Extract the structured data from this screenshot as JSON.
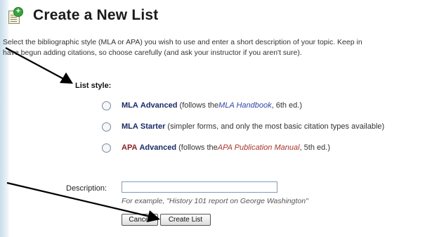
{
  "header": {
    "title": "Create a New List",
    "icon": "new-list-icon"
  },
  "intro": {
    "line1": "Select the bibliographic style (MLA or APA) you wish to use and enter a short description of your topic. Keep in",
    "line2": "have begun adding citations, so choose carefully (and ask your instructor if you aren't sure)."
  },
  "list_style": {
    "label": "List style:",
    "options": [
      {
        "name_part1": "MLA",
        "name_part2": "Advanced",
        "pre": "(follows the ",
        "ref": "MLA Handbook",
        "post": ", 6th ed.)",
        "selected": false
      },
      {
        "name_part1": "MLA",
        "name_part2": "Starter",
        "desc": "(simpler forms, and only the most basic citation types available)",
        "selected": false
      },
      {
        "name_part1": "APA",
        "name_part2": "Advanced",
        "pre": "(follows the ",
        "ref": "APA Publication Manual",
        "post": ", 5th ed.)",
        "selected": false
      }
    ]
  },
  "description": {
    "label": "Description:",
    "value": "",
    "hint": "For example, \"History 101 report on George Washington\""
  },
  "buttons": {
    "cancel": "Cancel",
    "create": "Create List"
  },
  "colors": {
    "mla_name": "#1a2a66",
    "apa_name": "#8a1f1f",
    "mla_ref": "#3345a8",
    "apa_ref": "#a8342c"
  }
}
